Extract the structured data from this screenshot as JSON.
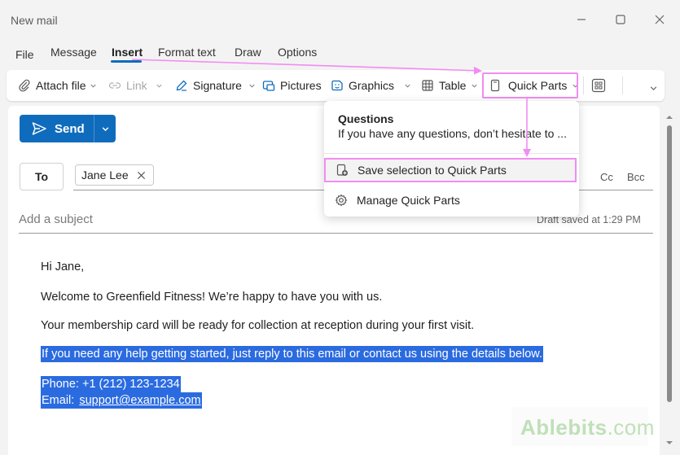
{
  "window": {
    "title": "New mail"
  },
  "menu": {
    "tabs": [
      "File",
      "Message",
      "Insert",
      "Format text",
      "Draw",
      "Options"
    ],
    "active": "Insert"
  },
  "ribbon": {
    "attach_file": "Attach file",
    "link": "Link",
    "signature": "Signature",
    "pictures": "Pictures",
    "graphics": "Graphics",
    "table": "Table",
    "quick_parts": "Quick Parts"
  },
  "compose": {
    "send_label": "Send",
    "to_label": "To",
    "recipient": "Jane Lee",
    "cc_label": "Cc",
    "bcc_label": "Bcc",
    "subject_placeholder": "Add a subject",
    "draft_status": "Draft saved at 1:29 PM"
  },
  "body": {
    "greeting": "Hi Jane,",
    "line1": "Welcome to Greenfield Fitness! We’re happy to have you with us.",
    "line2": "Your membership card will be ready for collection at reception during your first visit.",
    "line3": "If you need any help getting started, just reply to this email or contact us using the details below.",
    "phone": "Phone: +1 (212) 123-1234",
    "email_label": "Email: ",
    "email_link": "support@example.com"
  },
  "quick_parts_menu": {
    "saved_title": "Questions",
    "saved_preview": "If you have any questions, don’t hesitate to ...",
    "save_selection": "Save selection to Quick Parts",
    "manage": "Manage Quick Parts"
  },
  "watermark": {
    "brand": "Ablebits",
    "suffix": ".com"
  },
  "colors": {
    "accent": "#0f6cbd",
    "highlight": "#2b6be0",
    "annotation": "#f28cf2"
  }
}
